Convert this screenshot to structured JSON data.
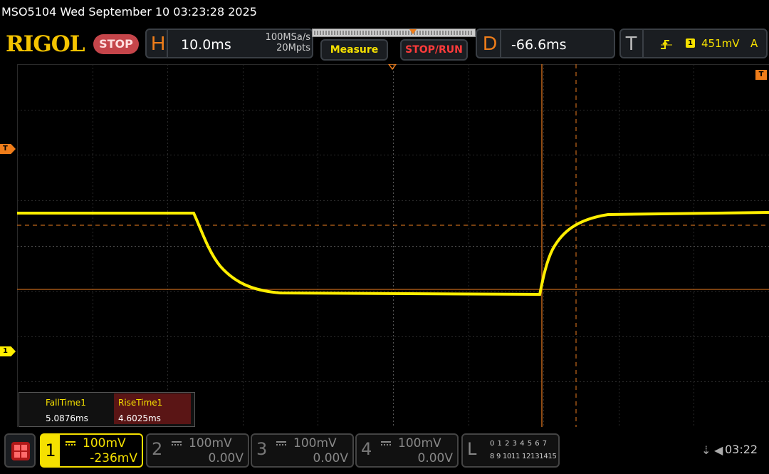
{
  "titlebar": {
    "text": "MSO5104  Wed September 10 03:23:28 2025"
  },
  "brand": {
    "logo": "RIGOL",
    "run_state": "STOP"
  },
  "horizontal": {
    "letter": "H",
    "timebase": "10.0ms",
    "sample_rate": "100MSa/s",
    "memory_depth": "20Mpts"
  },
  "buttons": {
    "measure": "Measure",
    "stop_run": "STOP/RUN"
  },
  "delay": {
    "letter": "D",
    "value": "-66.6ms"
  },
  "trigger": {
    "letter": "T",
    "source_badge": "1",
    "level": "451mV",
    "mode": "A"
  },
  "markers": {
    "trigger_level": "T",
    "channel1": "1",
    "trigger_right": "T"
  },
  "measurements": [
    {
      "label": "FallTime1",
      "value": "5.0876ms"
    },
    {
      "label": "RiseTime1",
      "value": "4.6025ms"
    }
  ],
  "channels": [
    {
      "number": "1",
      "scale": "100mV",
      "offset": "-236mV",
      "active": true
    },
    {
      "number": "2",
      "scale": "100mV",
      "offset": "0.00V",
      "active": false
    },
    {
      "number": "3",
      "scale": "100mV",
      "offset": "0.00V",
      "active": false
    },
    {
      "number": "4",
      "scale": "100mV",
      "offset": "0.00V",
      "active": false
    }
  ],
  "logic": {
    "letter": "L",
    "row1": "0 1 2 3  4 5 6 7",
    "row2": "8 9 1011 12131415"
  },
  "clock": {
    "time": "03:22"
  },
  "colors": {
    "trace": "#ffee00",
    "accent": "#ef7d1a",
    "stop": "#c5454a",
    "panel": "#1a1d21"
  }
}
